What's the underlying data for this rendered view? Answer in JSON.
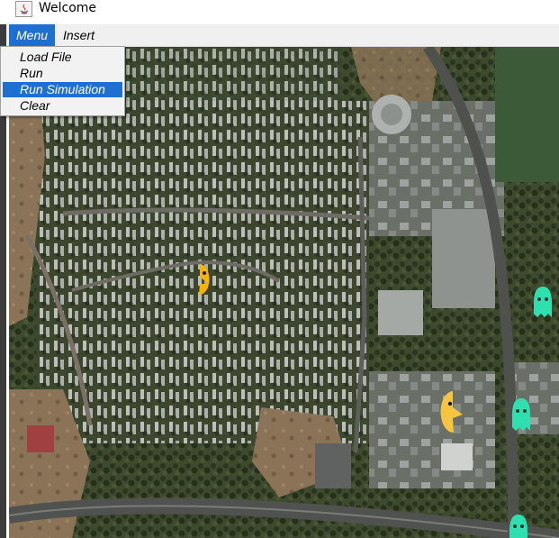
{
  "window": {
    "title": "Welcome"
  },
  "menubar": {
    "items": [
      {
        "label": "Menu"
      },
      {
        "label": "Insert"
      }
    ]
  },
  "dropdown": {
    "items": [
      {
        "label": "Load File"
      },
      {
        "label": "Run"
      },
      {
        "label": "Run Simulation"
      },
      {
        "label": "Clear"
      }
    ],
    "selected": "Run Simulation"
  },
  "map": {
    "type": "satellite",
    "sprites": [
      {
        "kind": "pacman-icon",
        "color": "#f5b400"
      },
      {
        "kind": "pacman-icon",
        "color": "#f5c542"
      },
      {
        "kind": "ghost-icon",
        "color": "#2ee0b0"
      },
      {
        "kind": "ghost-icon",
        "color": "#2ee0b0"
      },
      {
        "kind": "ghost-icon",
        "color": "#2ee0b0"
      }
    ]
  },
  "colors": {
    "accent": "#1f6fd0"
  }
}
